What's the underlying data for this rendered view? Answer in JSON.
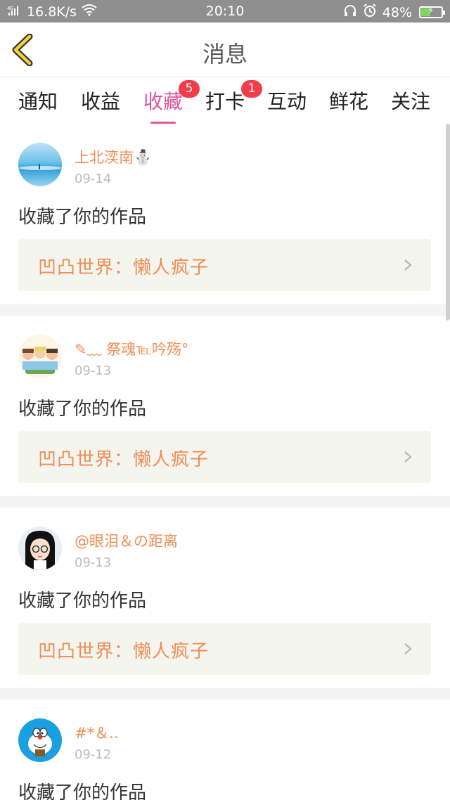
{
  "status_bar": {
    "network_type": "4G",
    "speed": "16.8K/s",
    "time": "20:10",
    "battery_percent": "48%",
    "battery_level": 0.48,
    "icons": [
      "signal-icon",
      "wifi-icon",
      "headphones-icon",
      "alarm-icon",
      "battery-charging-icon"
    ]
  },
  "nav": {
    "title": "消息",
    "back_icon": "chevron-left-icon",
    "accent_color": "#f5d33a"
  },
  "tabs": [
    {
      "label": "通知",
      "badge": ""
    },
    {
      "label": "收益",
      "badge": ""
    },
    {
      "label": "收藏",
      "badge": "5",
      "active": true
    },
    {
      "label": "打卡",
      "badge": "1"
    },
    {
      "label": "互动",
      "badge": ""
    },
    {
      "label": "鲜花",
      "badge": ""
    },
    {
      "label": "关注",
      "badge": ""
    }
  ],
  "colors": {
    "active_tab": "#e0569b",
    "username": "#f08d55",
    "badge": "#f23d49",
    "work_card_bg": "#f5f5f0"
  },
  "feed": [
    {
      "username": "上北湙南⛄",
      "date": "09-14",
      "action": "收藏了你的作品",
      "work_title": "凹凸世界：懒人疯子",
      "avatar": "sky-landscape-avatar"
    },
    {
      "username": "✎﹏ 祭魂℡吟殇°",
      "date": "09-13",
      "action": "收藏了你的作品",
      "work_title": "凹凸世界：懒人疯子",
      "avatar": "cartoon-group-avatar"
    },
    {
      "username": "@眼泪＆の距离",
      "date": "09-13",
      "action": "收藏了你的作品",
      "work_title": "凹凸世界：懒人疯子",
      "avatar": "anime-girl-avatar"
    },
    {
      "username": "#*＆..",
      "date": "09-12",
      "action": "收藏了你的作品",
      "work_title": "",
      "avatar": "doraemon-avatar"
    }
  ]
}
